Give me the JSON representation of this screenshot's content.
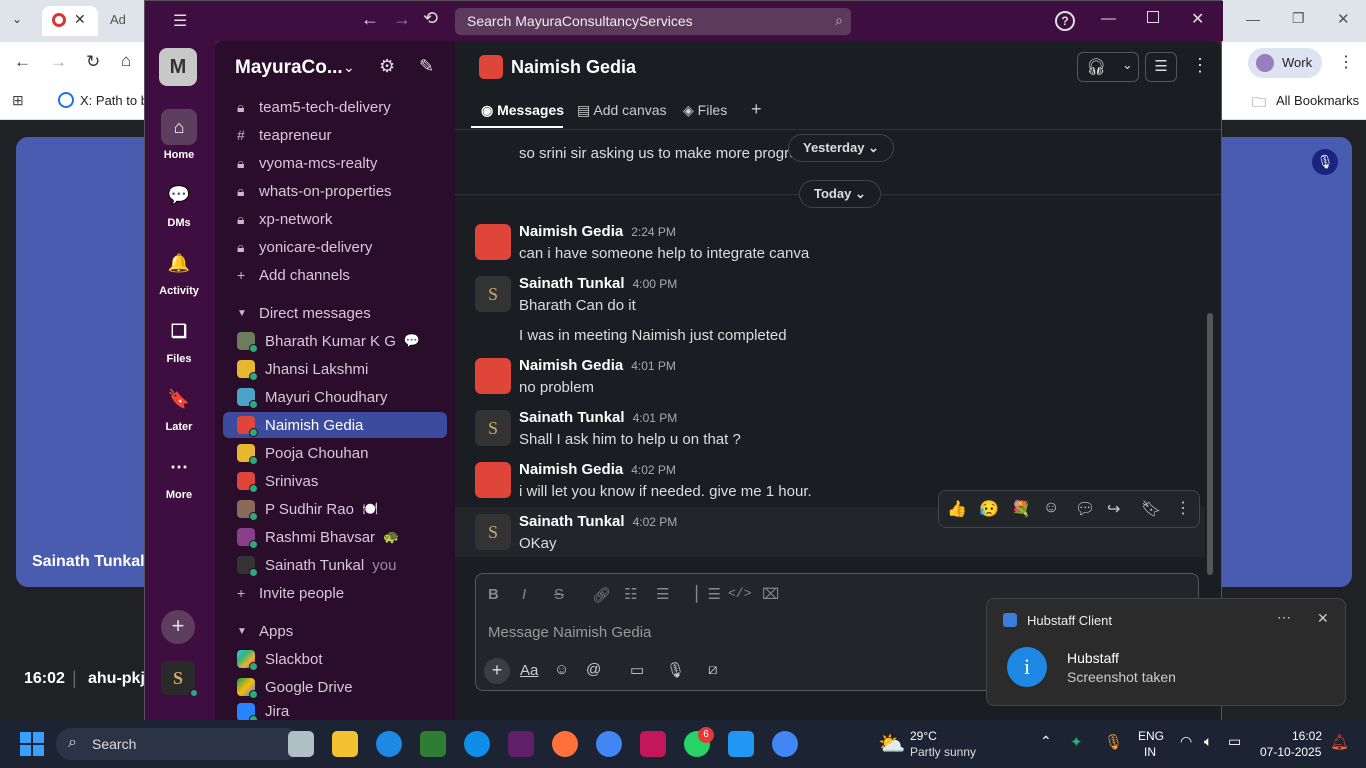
{
  "chrome": {
    "tab2_label": "Ad",
    "bookmark1": "X: Path to be",
    "all_bookmarks": "All Bookmarks",
    "profile": "Work"
  },
  "meet": {
    "participant_name": "Sainath Tunkal",
    "clock": "16:02",
    "meeting_code": "ahu-pkj"
  },
  "slack": {
    "search_placeholder": "Search MayuraConsultancyServices",
    "workspace_initial": "M",
    "workspace_name": "MayuraCo...",
    "rail": [
      {
        "label": "Home",
        "icon": "home-icon"
      },
      {
        "label": "DMs",
        "icon": "dms-icon"
      },
      {
        "label": "Activity",
        "icon": "bell-icon"
      },
      {
        "label": "Files",
        "icon": "files-icon"
      },
      {
        "label": "Later",
        "icon": "bookmark-icon"
      },
      {
        "label": "More",
        "icon": "more-icon"
      }
    ],
    "channels": [
      {
        "name": "team5-tech-delivery",
        "icon": "lock-icon"
      },
      {
        "name": "teapreneur",
        "icon": "hash-icon"
      },
      {
        "name": "vyoma-mcs-realty",
        "icon": "lock-icon"
      },
      {
        "name": "whats-on-properties",
        "icon": "lock-icon"
      },
      {
        "name": "xp-network",
        "icon": "lock-icon"
      },
      {
        "name": "yonicare-delivery",
        "icon": "lock-icon"
      }
    ],
    "add_channels": "Add channels",
    "dm_header": "Direct messages",
    "dms": [
      {
        "name": "Bharath Kumar K G",
        "status": "💬",
        "color": "#6b7d5c"
      },
      {
        "name": "Jhansi Lakshmi",
        "status": "",
        "color": "#e8b730"
      },
      {
        "name": "Mayuri Choudhary",
        "status": "",
        "color": "#4aa3c9"
      },
      {
        "name": "Naimish Gedia",
        "status": "",
        "color": "#e0453a"
      },
      {
        "name": "Pooja Chouhan",
        "status": "",
        "color": "#e8b730"
      },
      {
        "name": "Srinivas",
        "status": "",
        "color": "#e0453a"
      },
      {
        "name": "P Sudhir Rao",
        "status": "🍽️",
        "color": "#8a6a5a"
      },
      {
        "name": "Rashmi Bhavsar",
        "status": "🐢",
        "color": "#8a3f8a"
      },
      {
        "name": "Sainath Tunkal",
        "status": "you",
        "color": "#333"
      }
    ],
    "invite_people": "Invite people",
    "apps_header": "Apps",
    "apps": [
      "Slackbot",
      "Google Drive",
      "Jira"
    ],
    "channel_title": "Naimish Gedia",
    "tabs": [
      "Messages",
      "Add canvas",
      "Files"
    ],
    "prev_msg": "so srini sir asking us to make more progre",
    "yesterday": "Yesterday",
    "today": "Today",
    "messages": [
      {
        "name": "Naimish Gedia",
        "time": "2:24 PM",
        "text": "can i have someone help to integrate canva",
        "avatar": "#e0453a"
      },
      {
        "name": "Sainath Tunkal",
        "time": "4:00 PM",
        "text": "Bharath Can do it",
        "text2": "I was in meeting Naimish just completed",
        "avatar": "#333"
      },
      {
        "name": "Naimish Gedia",
        "time": "4:01 PM",
        "text": "no problem",
        "avatar": "#e0453a"
      },
      {
        "name": "Sainath Tunkal",
        "time": "4:01 PM",
        "text": "Shall I ask him to help u on that ?",
        "avatar": "#333"
      },
      {
        "name": "Naimish Gedia",
        "time": "4:02 PM",
        "text": "i will let you know if needed. give me 1 hour.",
        "avatar": "#e0453a"
      },
      {
        "name": "Sainath Tunkal",
        "time": "4:02 PM",
        "text": "OKay",
        "avatar": "#333"
      }
    ],
    "composer_placeholder": "Message Naimish Gedia"
  },
  "hubstaff": {
    "app": "Hubstaff Client",
    "title": "Hubstaff",
    "body": "Screenshot taken"
  },
  "taskbar": {
    "search": "Search",
    "weather_temp": "29°C",
    "weather_desc": "Partly sunny",
    "lang1": "ENG",
    "lang2": "IN",
    "time": "16:02",
    "date": "07-10-2025",
    "whatsapp_badge": "6"
  }
}
